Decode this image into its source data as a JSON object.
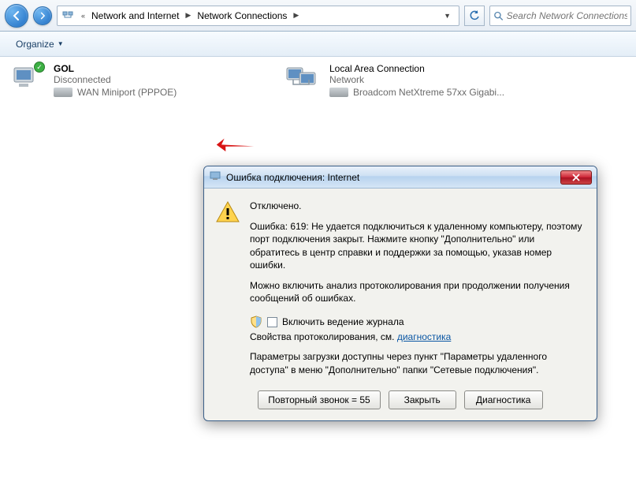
{
  "toolbar": {
    "breadcrumb": {
      "item1": "Network and Internet",
      "item2": "Network Connections"
    },
    "search_placeholder": "Search Network Connections"
  },
  "cmdbar": {
    "organize": "Organize"
  },
  "connections": [
    {
      "name": "GOL",
      "status": "Disconnected",
      "adapter": "WAN Miniport (PPPOE)"
    },
    {
      "name": "Local Area Connection",
      "status": "Network",
      "adapter": "Broadcom NetXtreme 57xx Gigabi..."
    }
  ],
  "dialog": {
    "title": "Ошибка подключения: Internet",
    "state": "Отключено.",
    "error_msg": "Ошибка: 619: Не удается подключиться к удаленному компьютеру, поэтому порт подключения закрыт. Нажмите кнопку \"Дополнительно\" или обратитесь в центр справки и поддержки за помощью, указав номер ошибки.",
    "log_hint": "Можно включить анализ протоколирования при продолжении получения сообщений об ошибках.",
    "log_checkbox": "Включить ведение журнала",
    "log_props_prefix": "Свойства протоколирования, см. ",
    "log_props_link": "диагностика",
    "params_text": "Параметры загрузки доступны через пункт \"Параметры удаленного доступа\" в меню \"Дополнительно\" папки \"Сетевые подключения\".",
    "btn_redial": "Повторный звонок = 55",
    "btn_close": "Закрыть",
    "btn_diag": "Диагностика"
  }
}
